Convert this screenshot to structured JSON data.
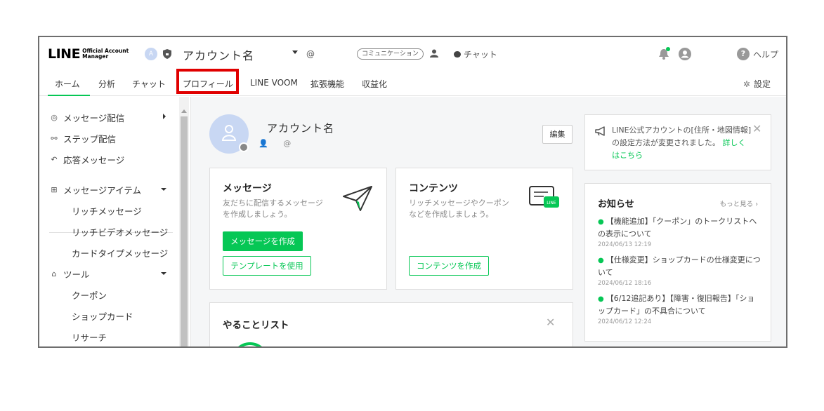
{
  "header": {
    "logo_main": "LINE",
    "logo_sub_1": "Official Account",
    "logo_sub_2": "Manager",
    "avatar_letter": "A",
    "account_name": "アカウント名",
    "account_at": "@",
    "communication_badge": "コミュニケーション",
    "chat_label": "チャット",
    "help_label": "ヘルプ"
  },
  "tabs": {
    "items": [
      "ホーム",
      "分析",
      "チャット",
      "プロフィール",
      "LINE VOOM",
      "拡張機能",
      "収益化"
    ],
    "active_index": 0,
    "highlighted_index": 3,
    "settings_label": "設定"
  },
  "sidebar": {
    "items": [
      {
        "label": "メッセージ配信",
        "icon": "broadcast-icon",
        "arrow": "right"
      },
      {
        "label": "ステップ配信",
        "icon": "step-icon"
      },
      {
        "label": "応答メッセージ",
        "icon": "reply-icon"
      },
      {
        "label": "メッセージアイテム",
        "icon": "message-item-icon",
        "arrow": "down"
      },
      {
        "label": "ツール",
        "icon": "tool-icon",
        "arrow": "down"
      }
    ],
    "subitems_message": [
      "リッチメッセージ",
      "リッチビデオメッセージ",
      "カードタイプメッセージ"
    ],
    "subitems_tool": [
      "クーポン",
      "ショップカード",
      "リサーチ"
    ]
  },
  "profile": {
    "name": "アカウント名",
    "at": "@",
    "edit_label": "編集"
  },
  "cards": {
    "message": {
      "title": "メッセージ",
      "desc_1": "友だちに配信するメッセージ",
      "desc_2": "を作成しましょう。",
      "primary_button": "メッセージを作成",
      "secondary_button": "テンプレートを使用"
    },
    "content": {
      "title": "コンテンツ",
      "desc_1": "リッチメッセージやクーポン",
      "desc_2": "などを作成しましょう。",
      "button": "コンテンツを作成",
      "icon_label": "LINE"
    }
  },
  "notice": {
    "text": "LINE公式アカウントの[住所・地図情報]の設定方法が変更されました。",
    "link": "詳しくはこちら"
  },
  "news": {
    "title": "お知らせ",
    "more": "もっと見る",
    "items": [
      {
        "text": "【機能追加】「クーポン」のトークリストへの表示について",
        "date": "2024/06/13 12:19"
      },
      {
        "text": "【仕様変更】ショップカードの仕様変更について",
        "date": "2024/06/12 18:16"
      },
      {
        "text": "【6/12追記あり】【障害・復旧報告】「ショップカード」の不具合について",
        "date": "2024/06/12 12:24"
      }
    ]
  },
  "todo": {
    "title": "やることリスト"
  },
  "colors": {
    "accent_green": "#06c755",
    "highlight_red": "#e00000",
    "avatar_blue": "#c8d7f3"
  }
}
